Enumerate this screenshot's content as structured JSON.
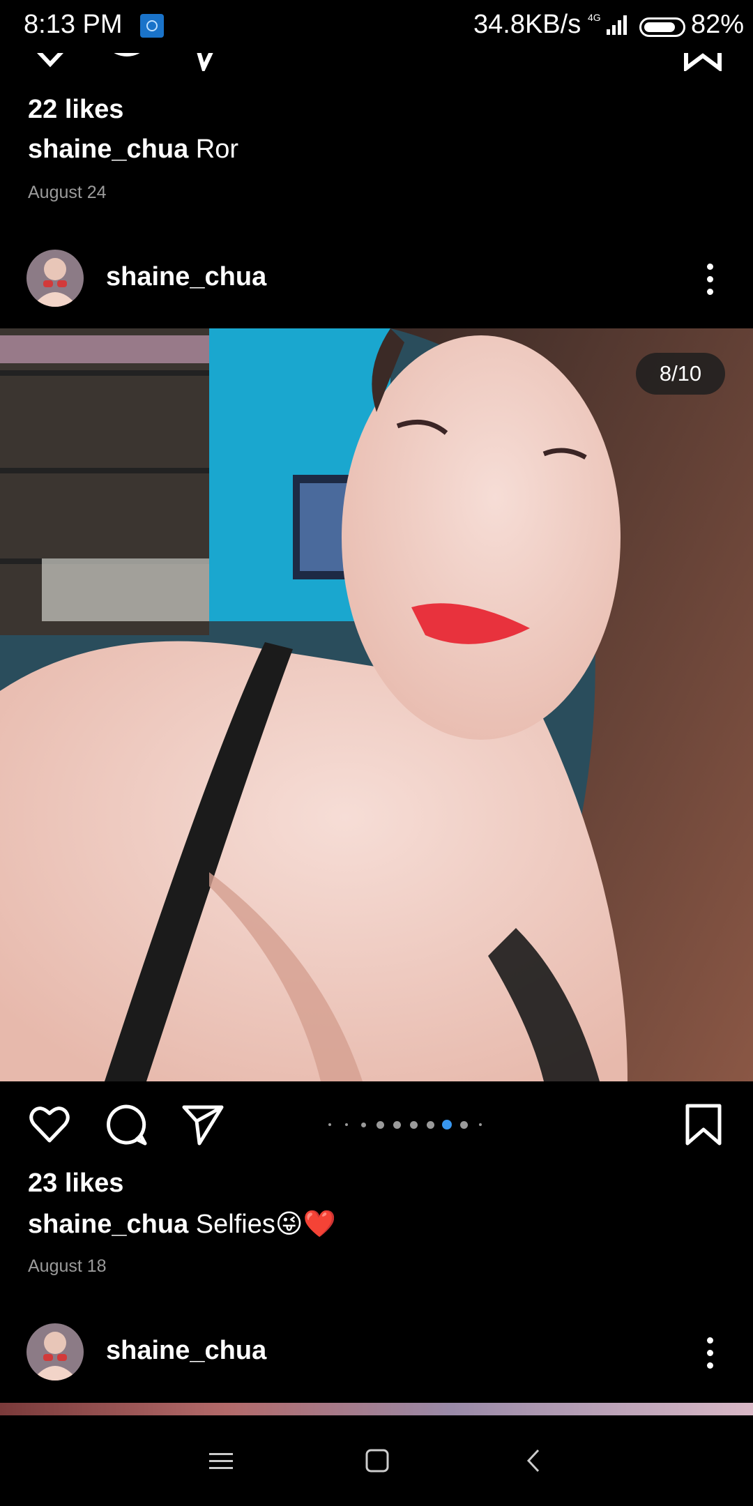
{
  "status_bar": {
    "time": "8:13 PM",
    "net_speed": "34.8KB/s",
    "network_type": "4G",
    "battery_percent": "82%",
    "battery_level": 0.82
  },
  "post_prev": {
    "likes": "22 likes",
    "username": "shaine_chua",
    "caption": "Ror",
    "date": "August 24"
  },
  "post_current": {
    "username": "shaine_chua",
    "image_counter": "8/10",
    "carousel": {
      "count": 10,
      "active_index": 8
    },
    "likes": "23 likes",
    "caption_username": "shaine_chua",
    "caption": "Selfies😜❤️",
    "date": "August 18"
  },
  "post_next": {
    "username": "shaine_chua"
  },
  "icons": {
    "like": "heart-icon",
    "comment": "comment-icon",
    "share": "send-icon",
    "save": "bookmark-icon",
    "more": "more-vertical-icon",
    "nav_menu": "menu-icon",
    "nav_home": "home-square-icon",
    "nav_back": "back-chevron-icon"
  },
  "colors": {
    "background": "#000000",
    "active_dot": "#3897f0",
    "date_text": "#9b9b9b"
  }
}
